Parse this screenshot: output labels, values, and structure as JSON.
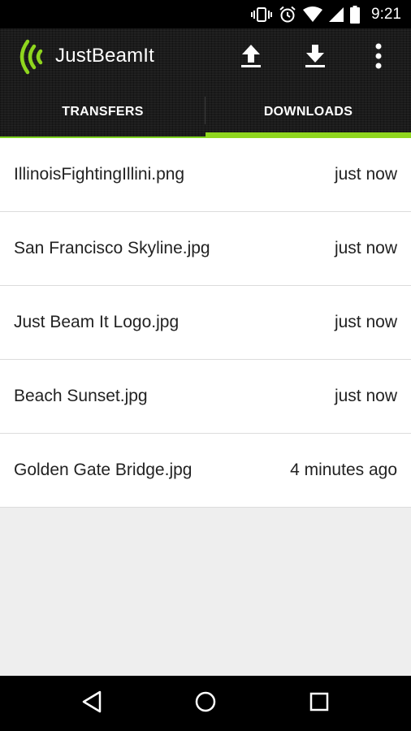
{
  "status_bar": {
    "time": "9:21",
    "icons": [
      "vibrate-icon",
      "alarm-icon",
      "wifi-icon",
      "cell-signal-icon",
      "battery-icon"
    ]
  },
  "toolbar": {
    "app_title": "JustBeamIt",
    "logo_icon": "beam-logo-icon",
    "actions": [
      "upload-icon",
      "download-icon",
      "overflow-menu-icon"
    ]
  },
  "tabs": [
    {
      "label": "TRANSFERS",
      "selected": false
    },
    {
      "label": "DOWNLOADS",
      "selected": true
    }
  ],
  "downloads": [
    {
      "name": "IllinoisFightingIllini.png",
      "time": "just now"
    },
    {
      "name": "San Francisco Skyline.jpg",
      "time": "just now"
    },
    {
      "name": "Just Beam It Logo.jpg",
      "time": "just now"
    },
    {
      "name": "Beach Sunset.jpg",
      "time": "just now"
    },
    {
      "name": "Golden Gate Bridge.jpg",
      "time": "4 minutes ago"
    }
  ],
  "nav_bar": {
    "buttons": [
      "back-icon",
      "home-icon",
      "recents-icon"
    ]
  },
  "colors": {
    "accent": "#8fd61e",
    "header_bg": "#1b1b1b",
    "list_bg": "#ffffff",
    "empty_bg": "#eeeeee"
  }
}
